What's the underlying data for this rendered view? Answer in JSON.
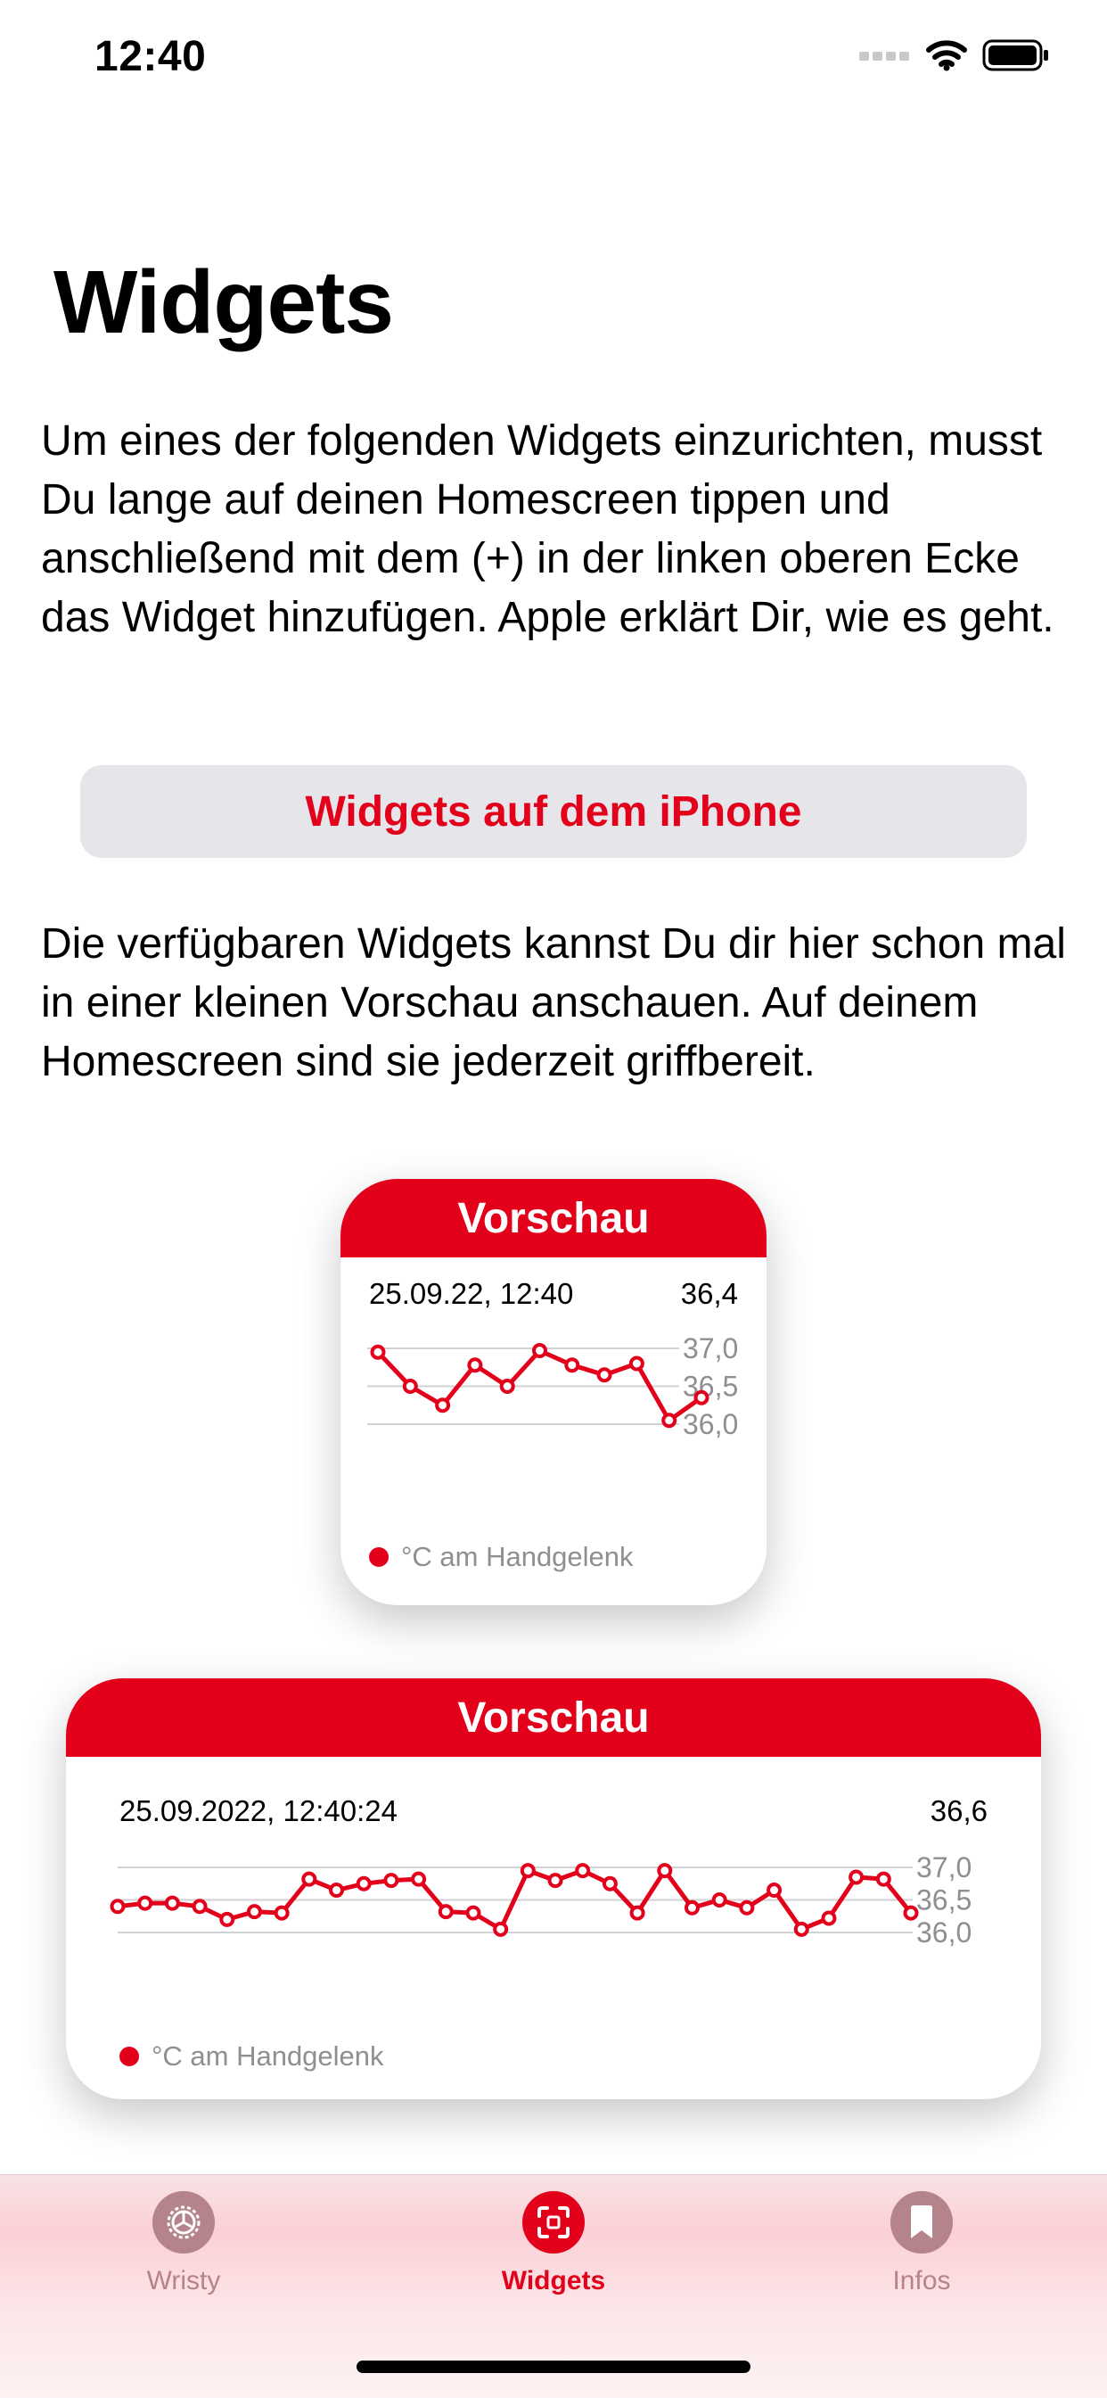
{
  "status_bar": {
    "time": "12:40"
  },
  "page": {
    "title": "Widgets",
    "intro": "Um eines der folgenden Widgets einzurichten, musst Du lange auf deinen Homescreen tippen und anschließend mit dem (+) in der linken oberen Ecke das Widget hinzufügen. Apple erklärt Dir, wie es geht.",
    "button_label": "Widgets auf dem iPhone",
    "preview_text": "Die verfügbaren Widgets kannst Du dir hier schon mal in einer kleinen Vorschau anschauen. Auf deinem Homescreen sind sie jederzeit griffbereit."
  },
  "colors": {
    "accent": "#e3001b",
    "button_bg": "#e5e5ea",
    "secondary_text": "#8e8e93",
    "tab_inactive": "#b5848a"
  },
  "widgets": {
    "small": {
      "header": "Vorschau",
      "date": "25.09.22, 12:40",
      "value": "36,4",
      "legend": "°C am Handgelenk"
    },
    "large": {
      "header": "Vorschau",
      "date": "25.09.2022, 12:40:24",
      "value": "36,6",
      "legend": "°C am Handgelenk"
    }
  },
  "chart_data": [
    {
      "type": "line",
      "series": [
        {
          "values": [
            36.95,
            36.5,
            36.25,
            36.78,
            36.5,
            36.97,
            36.78,
            36.65,
            36.8,
            36.05,
            36.35
          ]
        }
      ],
      "ylim": [
        36.0,
        37.0
      ],
      "yticks": [
        "37,0",
        "36,5",
        "36,0"
      ],
      "grid": true
    },
    {
      "type": "line",
      "series": [
        {
          "values": [
            36.4,
            36.45,
            36.45,
            36.4,
            36.2,
            36.32,
            36.3,
            36.82,
            36.65,
            36.75,
            36.8,
            36.82,
            36.32,
            36.3,
            36.05,
            36.95,
            36.8,
            36.95,
            36.75,
            36.3,
            36.95,
            36.38,
            36.5,
            36.38,
            36.65,
            36.05,
            36.22,
            36.85,
            36.82,
            36.3
          ]
        }
      ],
      "ylim": [
        36.0,
        37.0
      ],
      "yticks": [
        "37,0",
        "36,5",
        "36,0"
      ],
      "grid": true
    }
  ],
  "tabs": [
    {
      "label": "Wristy",
      "icon": "gear-icon",
      "active": false
    },
    {
      "label": "Widgets",
      "icon": "viewfinder-icon",
      "active": true
    },
    {
      "label": "Infos",
      "icon": "bookmark-icon",
      "active": false
    }
  ]
}
